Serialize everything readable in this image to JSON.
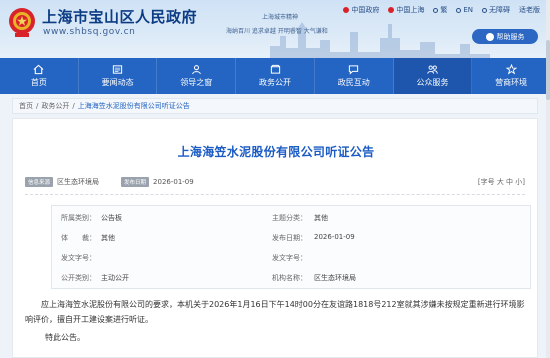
{
  "header": {
    "site_title": "上海市宝山区人民政府",
    "site_url": "www.shbsq.gov.cn",
    "brand_mid": "上海城市精神",
    "brand_slogan": "海纳百川 追求卓越 开明睿智 大气谦和",
    "top_links": [
      {
        "label": "中国政府",
        "icon": "emblem-icon"
      },
      {
        "label": "中国上海",
        "icon": "emblem-icon"
      },
      {
        "label": "繁",
        "icon": "search-icon"
      },
      {
        "label": "EN",
        "icon": "en-icon"
      },
      {
        "label": "无障碍",
        "icon": "accessibility-icon"
      },
      {
        "label": "适老版",
        "icon": ""
      }
    ],
    "help_label": "帮助服务"
  },
  "nav": {
    "items": [
      {
        "label": "首页",
        "icon": "home-icon"
      },
      {
        "label": "要闻动态",
        "icon": "news-icon"
      },
      {
        "label": "领导之窗",
        "icon": "leader-icon"
      },
      {
        "label": "政务公开",
        "icon": "open-icon"
      },
      {
        "label": "政民互动",
        "icon": "chat-icon"
      },
      {
        "label": "公众服务",
        "icon": "service-icon"
      },
      {
        "label": "营商环境",
        "icon": "business-icon"
      }
    ]
  },
  "breadcrumb": {
    "home": "首页",
    "sep": "/",
    "section": "政务公开",
    "current": "上海海笠水泥股份有限公司听证公告"
  },
  "article": {
    "title": "上海海笠水泥股份有限公司听证公告",
    "source_tag": "信息来源",
    "source": "区生态环境局",
    "date_tag": "发布日期",
    "date": "2026-01-09",
    "font_size_label": "[字号 大 中 小]",
    "info": [
      {
        "k1": "所属类别：",
        "v1": "公告板",
        "k2": "主题分类：",
        "v2": "其他"
      },
      {
        "k1": "体　　裁：",
        "v1": "其他",
        "k2": "发布日期：",
        "v2": "2026-01-09"
      },
      {
        "k1": "发文字号：",
        "v1": "",
        "k2": "发文字号：",
        "v2": ""
      },
      {
        "k1": "公开类别：",
        "v1": "主动公开",
        "k2": "机构名称：",
        "v2": "区生态环境局"
      }
    ],
    "body_p1": "应上海海笠水泥股份有限公司的要求，本机关于2026年1月16日下午14时00分在友谊路1818号212室就其涉嫌未按规定重新进行环境影响评价，擅自开工建设案进行听证。",
    "body_p2": "特此公告。"
  },
  "colors": {
    "primary": "#2464c2",
    "title_blue": "#1a5bc4",
    "header_title": "#0c3c84"
  }
}
